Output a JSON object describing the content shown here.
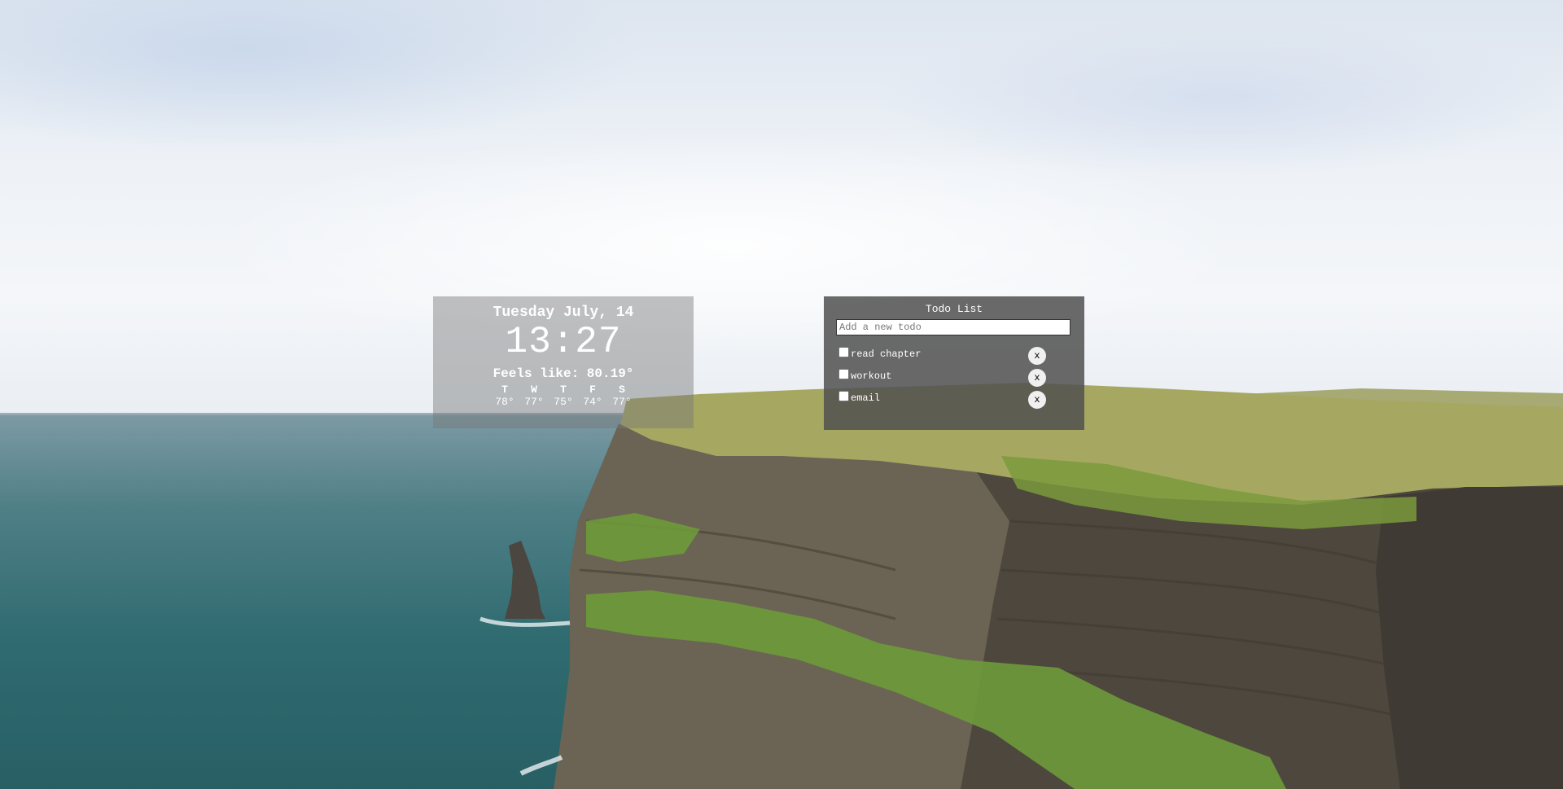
{
  "clock": {
    "date": "Tuesday July, 14",
    "time": "13:27",
    "feels_like": "Feels like: 80.19°"
  },
  "forecast": [
    {
      "day": "T",
      "temp": "78°"
    },
    {
      "day": "W",
      "temp": "77°"
    },
    {
      "day": "T",
      "temp": "75°"
    },
    {
      "day": "F",
      "temp": "74°"
    },
    {
      "day": "S",
      "temp": "77°"
    }
  ],
  "todo": {
    "title": "Todo List",
    "input_placeholder": "Add a new todo",
    "input_value": "",
    "delete_label": "x",
    "items": [
      {
        "text": "read chapter",
        "checked": false
      },
      {
        "text": "workout",
        "checked": false
      },
      {
        "text": "email",
        "checked": false
      }
    ]
  },
  "background": {
    "sky_color": "#eef2f7",
    "sea_color": "#2f6b70",
    "grass_color": "#7a9a3c",
    "cliff_color": "#5f5a4e"
  }
}
